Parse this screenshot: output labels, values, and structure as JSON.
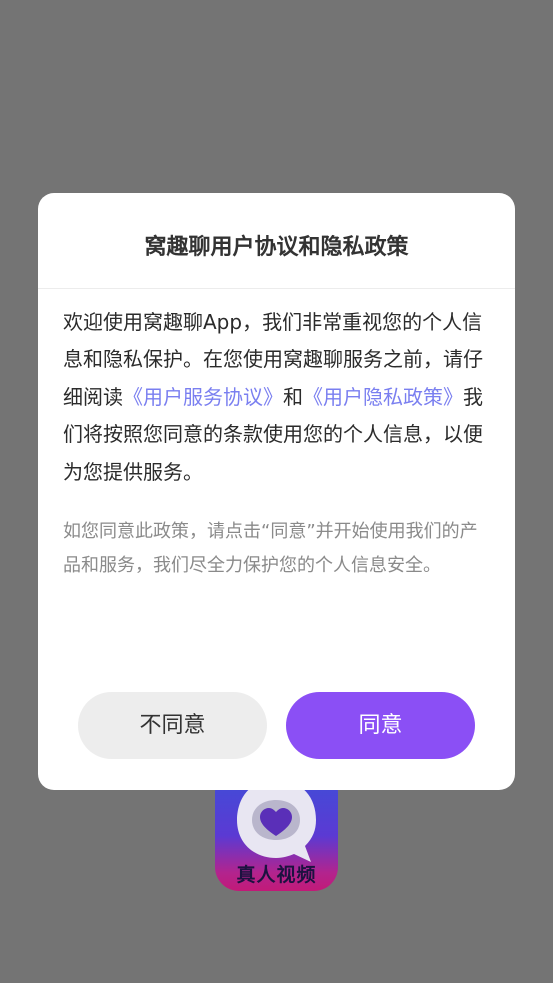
{
  "app_icon": {
    "label": "真人视频",
    "colors": {
      "top": "#3d4fd8",
      "bottom": "#c21a78"
    }
  },
  "dialog": {
    "title": "窝趣聊用户协议和隐私政策",
    "body": {
      "part1": "欢迎使用窝趣聊App，我们非常重视您的个人信息和隐私保护。在您使用窝趣聊服务之前，请仔细阅读",
      "link_service": "《用户服务协议》",
      "conjunction": "和",
      "link_privacy": "《用户隐私政策》",
      "part2": "我们将按照您同意的条款使用您的个人信息，以便为您提供服务。"
    },
    "hint": "如您同意此政策，请点击“同意”并开始使用我们的产品和服务，我们尽全力保护您的个人信息安全。",
    "buttons": {
      "disagree": "不同意",
      "agree": "同意"
    }
  },
  "colors": {
    "overlay": "#747474",
    "link": "#7a7ff0",
    "accent": "#8b4ff5",
    "secondary_button": "#ededed"
  }
}
